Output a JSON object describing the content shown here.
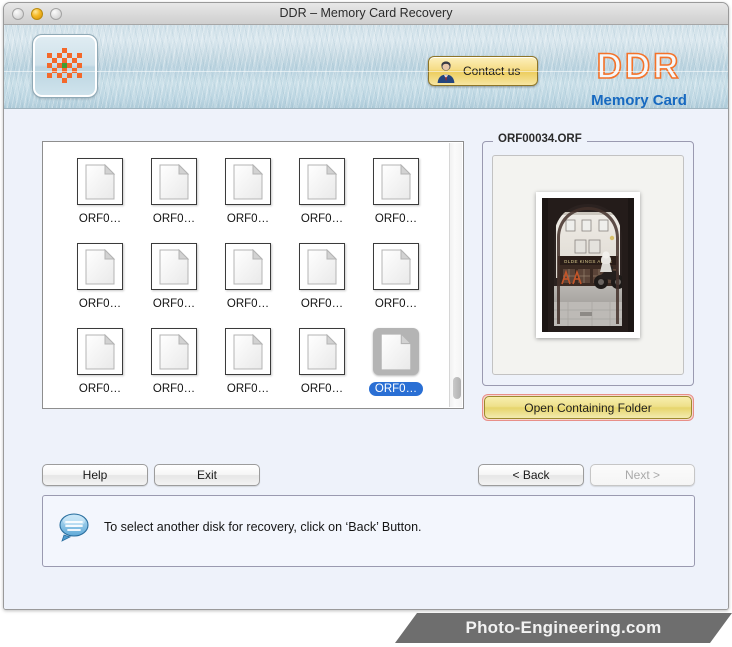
{
  "window": {
    "title": "DDR – Memory Card Recovery",
    "traffic_lights": [
      "close-disabled",
      "minimize-amber",
      "zoom-disabled"
    ]
  },
  "banner": {
    "app_icon_name": "memory-card-pattern-icon",
    "contact_button": {
      "label": "Contact us",
      "icon": "person-avatar-icon"
    },
    "brand": {
      "word": "DDR",
      "subtitle": "Memory Card",
      "word_stroke_color": "#f4732a",
      "subtitle_color": "#1769c0"
    }
  },
  "file_list": {
    "truncated_label": "ORF0…",
    "items": [
      {
        "label": "ORF0…",
        "selected": false
      },
      {
        "label": "ORF0…",
        "selected": false
      },
      {
        "label": "ORF0…",
        "selected": false
      },
      {
        "label": "ORF0…",
        "selected": false
      },
      {
        "label": "ORF0…",
        "selected": false
      },
      {
        "label": "ORF0…",
        "selected": false
      },
      {
        "label": "ORF0…",
        "selected": false
      },
      {
        "label": "ORF0…",
        "selected": false
      },
      {
        "label": "ORF0…",
        "selected": false
      },
      {
        "label": "ORF0…",
        "selected": false
      },
      {
        "label": "ORF0…",
        "selected": false
      },
      {
        "label": "ORF0…",
        "selected": false
      },
      {
        "label": "ORF0…",
        "selected": false
      },
      {
        "label": "ORF0…",
        "selected": false
      },
      {
        "label": "ORF0…",
        "selected": true
      }
    ],
    "selection_color": "#2a6fd4"
  },
  "preview": {
    "legend": "ORF00034.ORF",
    "image_description": "photograph through a dark stone archway of the Olde Kings Arms pub with a motorcycle parked outside",
    "image_sign_text": "OLDE KINGS ARMS",
    "open_folder_button": "Open Containing Folder",
    "open_folder_focus_ring_color": "#e88f88"
  },
  "buttons": {
    "help": "Help",
    "exit": "Exit",
    "back": "< Back",
    "next": "Next >",
    "next_disabled": true
  },
  "status": {
    "icon": "speech-bubble-icon",
    "message": "To select another disk for recovery, click on ‘Back’ Button."
  },
  "watermark": {
    "text": "Photo-Engineering.com"
  }
}
